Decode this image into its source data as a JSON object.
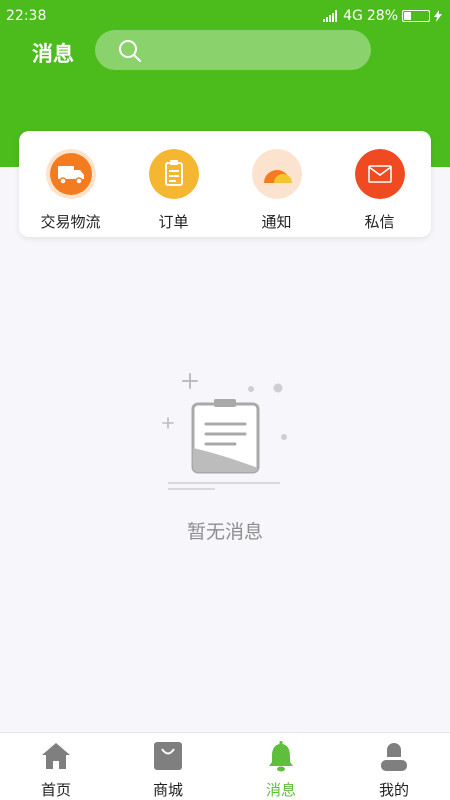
{
  "status_bar": {
    "time": "22:38",
    "network": "4G",
    "battery": "28%",
    "battery_level": 0.28
  },
  "header": {
    "title": "消息",
    "search_placeholder": ""
  },
  "quick_actions": [
    {
      "label": "交易物流",
      "icon": "truck-icon",
      "color": "#f47c20"
    },
    {
      "label": "订单",
      "icon": "clipboard-icon",
      "color": "#f5b731"
    },
    {
      "label": "通知",
      "icon": "notification-icon",
      "color": "#fbe3cf"
    },
    {
      "label": "私信",
      "icon": "mail-icon",
      "color": "#f04a23"
    }
  ],
  "empty_state": {
    "text": "暂无消息"
  },
  "tab_bar": [
    {
      "label": "首页",
      "icon": "home-icon",
      "active": false
    },
    {
      "label": "商城",
      "icon": "shopping-bag-icon",
      "active": false
    },
    {
      "label": "消息",
      "icon": "bell-icon",
      "active": true
    },
    {
      "label": "我的",
      "icon": "user-icon",
      "active": false
    }
  ],
  "colors": {
    "primary": "#4cbb1c",
    "active_tab": "#5fbf3c"
  }
}
